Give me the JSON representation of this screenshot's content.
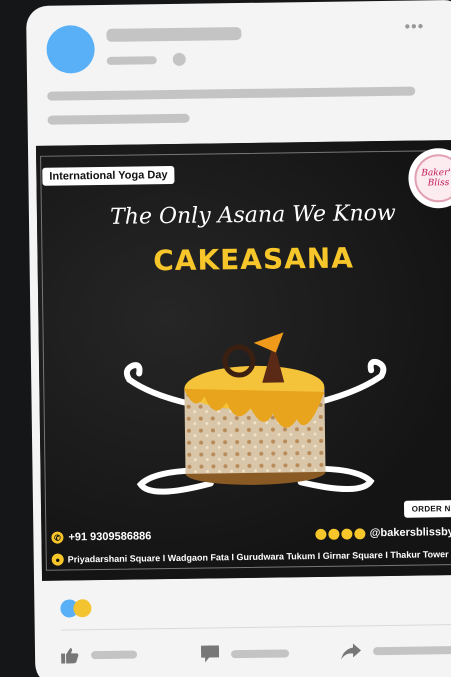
{
  "post": {
    "badge": "International Yoga Day",
    "logo": {
      "line1": "Baker's",
      "line2": "Bliss"
    },
    "headline": "The Only Asana We Know",
    "title": "CAKEASANA",
    "order_button": "ORDER NOW",
    "phone": "+91 9309586886",
    "social_handle": "@bakersblissbyswad",
    "address": "Priyadarshani Square I Wadgaon Fata I Gurudwara Tukum I Girnar Square I Thakur Tower",
    "colors": {
      "accent": "#f7c62a",
      "background": "#171717"
    }
  },
  "reactions": {
    "icons": [
      "like-reaction-icon",
      "haha-reaction-icon"
    ]
  },
  "actions": {
    "icons": [
      "thumbs-up-icon",
      "comment-icon",
      "share-icon"
    ]
  }
}
